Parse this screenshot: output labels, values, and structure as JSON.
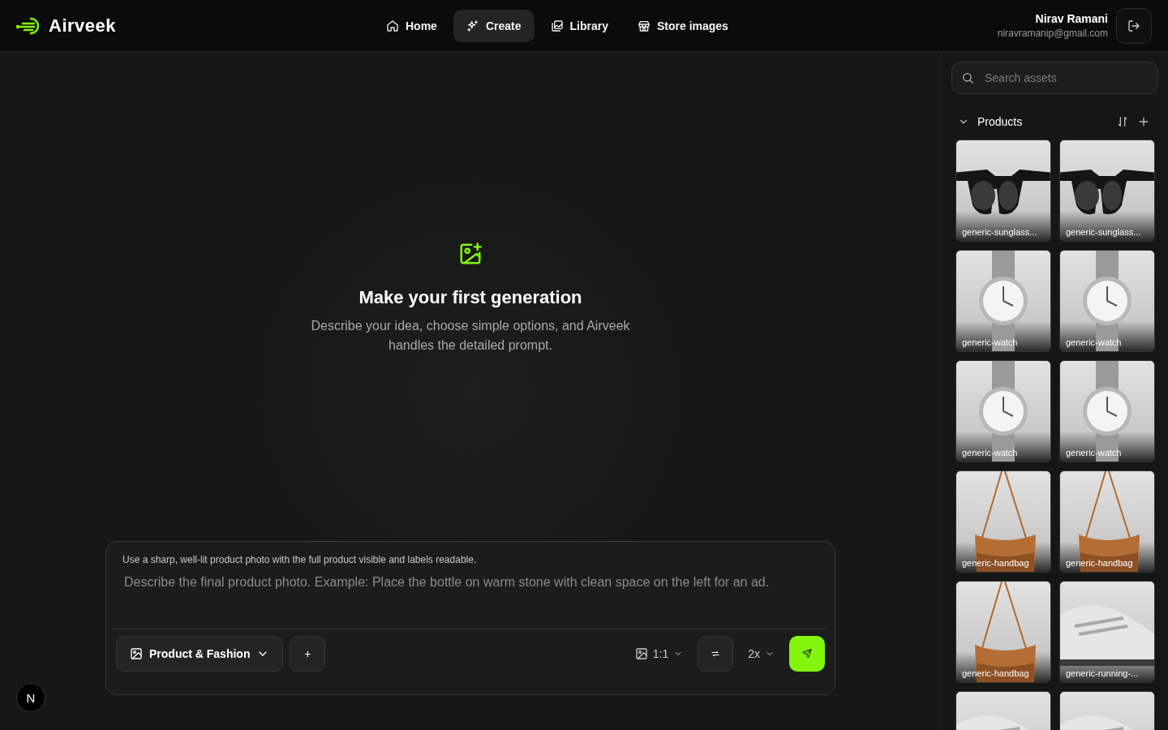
{
  "brand": {
    "name": "Airveek"
  },
  "nav": [
    {
      "label": "Home",
      "selected": false
    },
    {
      "label": "Create",
      "selected": true
    },
    {
      "label": "Library",
      "selected": false
    },
    {
      "label": "Store images",
      "selected": false
    }
  ],
  "user": {
    "name": "Nirav Ramani",
    "email": "niravramanip@gmail.com"
  },
  "empty_state": {
    "title": "Make your first generation",
    "description": "Describe your idea, choose simple options, and Airveek handles the detailed prompt."
  },
  "composer": {
    "hint": "Use a sharp, well-lit product photo with the full product visible and labels readable.",
    "placeholder": "Describe the final product photo. Example: Place the bottle on warm stone with clean space on the left for an ad.",
    "category": "Product & Fashion",
    "add": "+",
    "aspect_ratio": "1:1",
    "scale": "2x"
  },
  "dev_badge": "N",
  "sidebar": {
    "search": {
      "placeholder": "Search assets"
    },
    "section": {
      "title": "Products",
      "expanded": true
    },
    "assets": [
      {
        "label": "generic-sunglass...",
        "kind": "sunglasses"
      },
      {
        "label": "generic-sunglass...",
        "kind": "sunglasses"
      },
      {
        "label": "generic-watch",
        "kind": "watch"
      },
      {
        "label": "generic-watch",
        "kind": "watch"
      },
      {
        "label": "generic-watch",
        "kind": "watch"
      },
      {
        "label": "generic-watch",
        "kind": "watch"
      },
      {
        "label": "generic-handbag",
        "kind": "handbag"
      },
      {
        "label": "generic-handbag",
        "kind": "handbag"
      },
      {
        "label": "generic-handbag",
        "kind": "handbag"
      },
      {
        "label": "generic-running-...",
        "kind": "shoe"
      },
      {
        "kind": "shoe"
      },
      {
        "kind": "shoe"
      }
    ]
  }
}
